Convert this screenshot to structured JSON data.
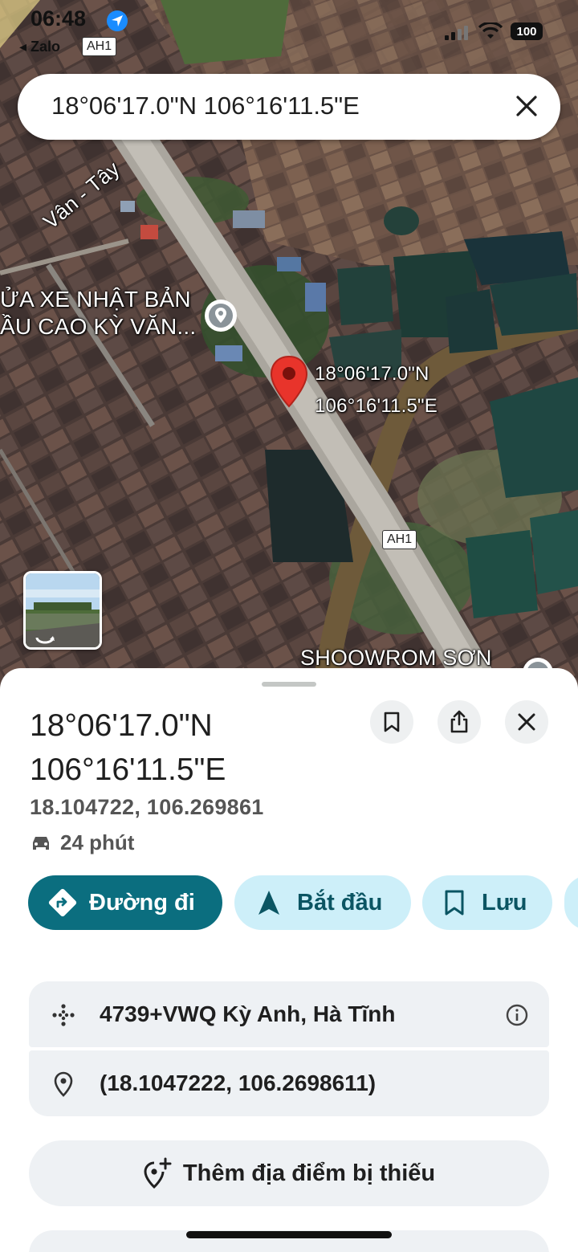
{
  "status_bar": {
    "time": "06:48",
    "back_app": "◂ Zalo",
    "battery": "100"
  },
  "search": {
    "query": "18°06'17.0\"N 106°16'11.5\"E"
  },
  "map": {
    "road_shield_top": "AH1",
    "road_shield_mid": "AH1",
    "street_name": "Vân - Tây",
    "poi_line1": "ỬA XE NHẬT BẢN",
    "poi_line2": "ẦU CAO KỲ VĂN...",
    "pin_lat": "18°06'17.0\"N",
    "pin_lng": "106°16'11.5\"E",
    "showroom": "SHOOWROM SƠN",
    "pin_color": "#e8342b"
  },
  "sheet": {
    "title_line1": "18°06'17.0\"N",
    "title_line2": "106°16'11.5\"E",
    "decimal_coords": "18.104722, 106.269861",
    "eta": "24 phút",
    "actions": {
      "directions": "Đường đi",
      "start": "Bắt đầu",
      "save": "Lưu"
    },
    "plus_code": "4739+VWQ Kỳ Anh, Hà Tĩnh",
    "coords_precise": "(18.1047222, 106.2698611)",
    "add_missing_place": "Thêm địa điểm bị thiếu"
  },
  "colors": {
    "primary": "#0b6e7f",
    "tonal": "#cdeff9",
    "card": "#eef1f4"
  }
}
